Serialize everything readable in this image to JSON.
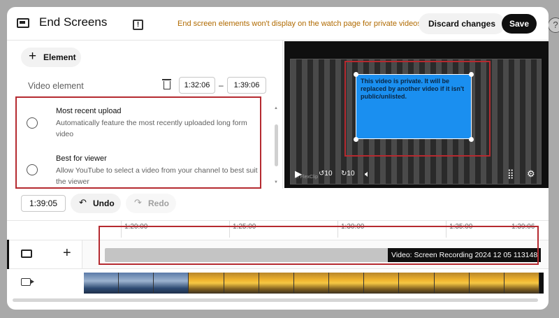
{
  "header": {
    "title": "End Screens",
    "notice": "End screen elements won't display on the watch page for private videos.",
    "discard_label": "Discard changes",
    "save_label": "Save"
  },
  "editor": {
    "add_element_label": "Element",
    "video_element_label": "Video element",
    "start_time": "1:32:06",
    "end_time": "1:39:06",
    "options": [
      {
        "title": "Most recent upload",
        "description": "Automatically feature the most recently uploaded long form video"
      },
      {
        "title": "Best for viewer",
        "description": "Allow YouTube to select a video from your channel to best suit the viewer"
      }
    ]
  },
  "preview": {
    "endcard_text": "This video is private. It will be replaced by another video if it isn't public/unlisted."
  },
  "playback": {
    "current_time": "1:39:05",
    "undo_label": "Undo",
    "redo_label": "Redo"
  },
  "timeline": {
    "ticks": [
      "1:20:00",
      "1:25:00",
      "1:30:00",
      "1:35:00",
      "1:39:06"
    ],
    "element_label": "Video: Screen Recording 2024 12 05 113148"
  },
  "icons": {
    "endscreen": "end-screen-icon",
    "feedback": "feedback-icon",
    "plus": "plus-icon",
    "trash": "trash-icon",
    "play": "play-icon",
    "rewind": "rewind-10-icon",
    "forward": "forward-10-icon",
    "volume": "volume-icon",
    "grid": "grid-icon",
    "settings": "gear-icon",
    "undo": "undo-icon",
    "redo": "redo-icon",
    "video": "video-camera-icon",
    "help": "help-icon"
  },
  "colors": {
    "accent_outline": "#b52a30",
    "endcard_fill": "#1a8ff0",
    "save_button": "#0f0f0f",
    "notice_text": "#b06a00"
  }
}
